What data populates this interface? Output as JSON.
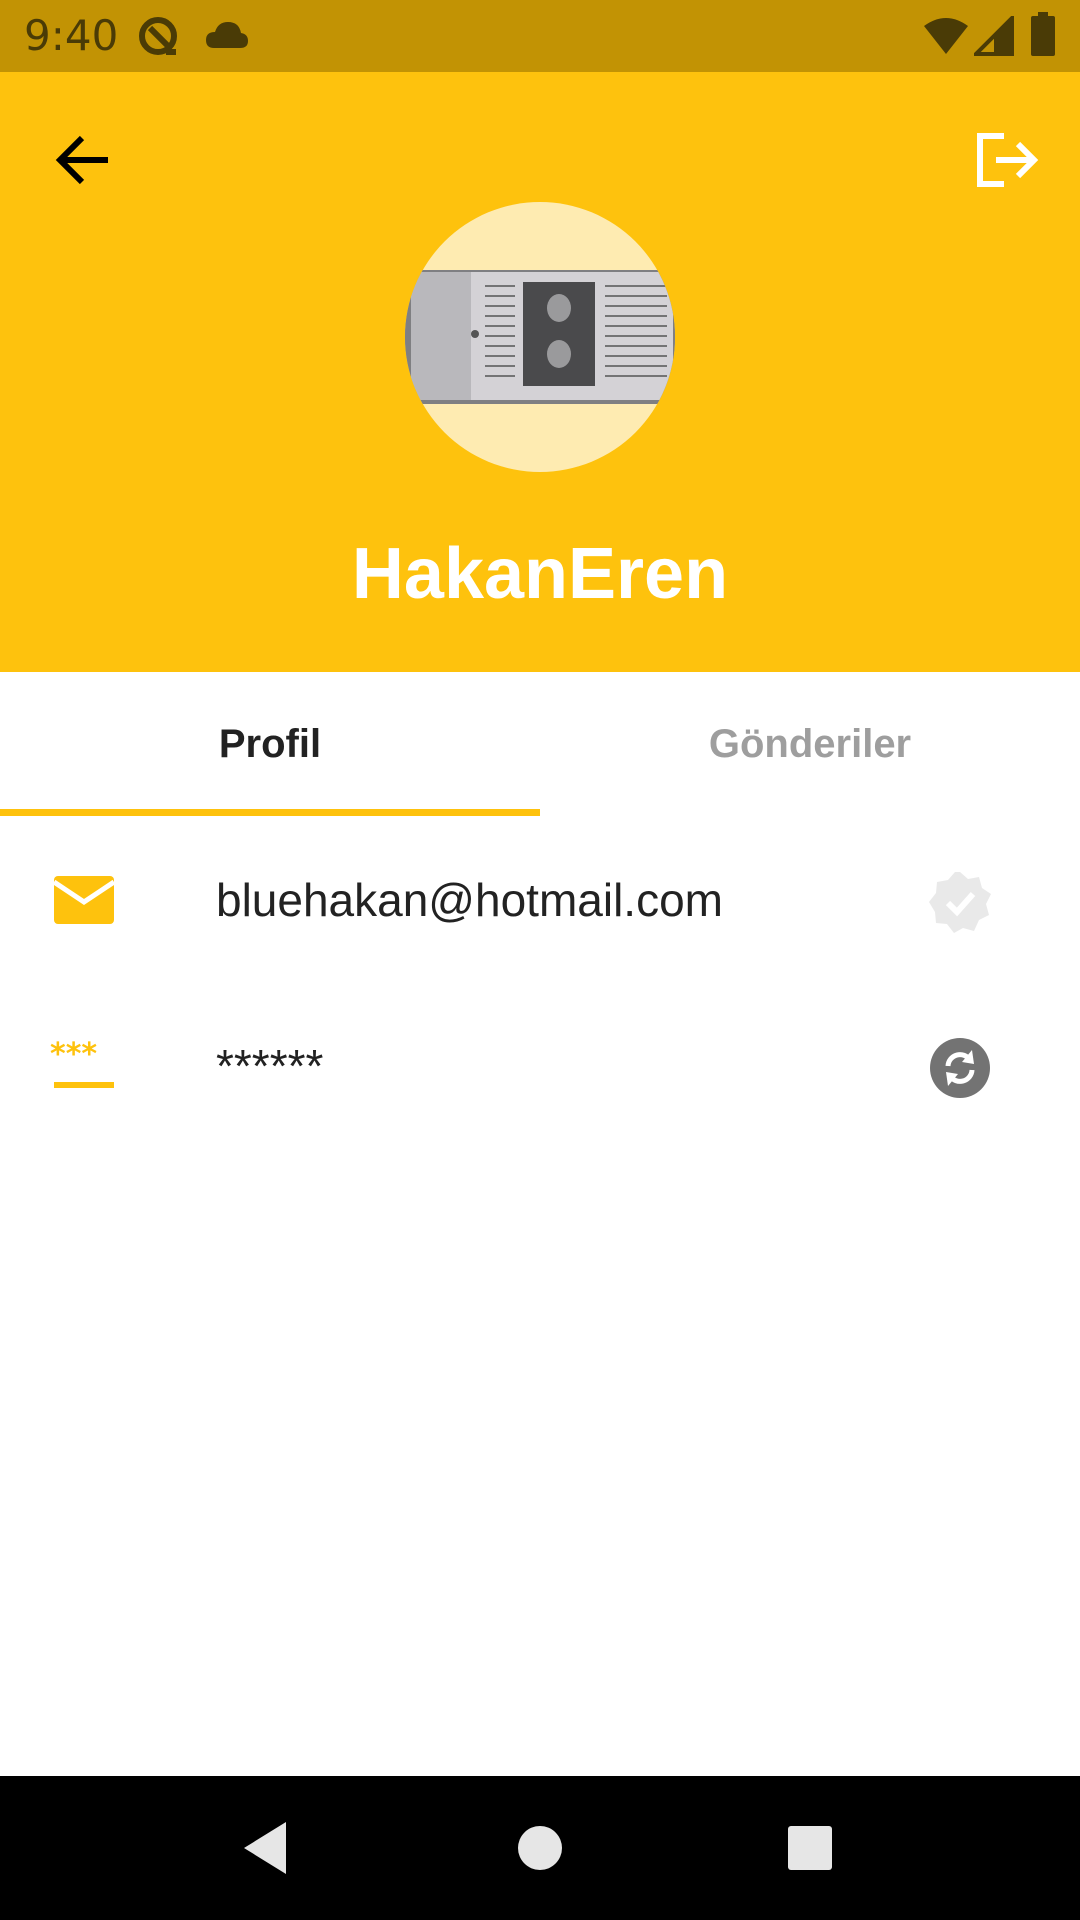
{
  "status_bar": {
    "time": "9:40",
    "left_icons": [
      "data-saver-icon",
      "cloud-icon"
    ],
    "right_icons": [
      "wifi-icon",
      "cell-signal-icon",
      "battery-icon"
    ]
  },
  "header": {
    "user_name": "HakanEren",
    "back_icon": "arrow-back-icon",
    "logout_icon": "logout-icon",
    "background_color": "#fec20d"
  },
  "tabs": [
    {
      "label": "Profil",
      "active": true
    },
    {
      "label": "Gönderiler",
      "active": false
    }
  ],
  "profile": {
    "email": "bluehakan@hotmail.com",
    "email_icon": "mail-icon",
    "email_status_icon": "verified-badge-icon",
    "password": "******",
    "password_icon": "password-icon",
    "password_action_icon": "sync-icon"
  },
  "nav_bar": {
    "buttons": [
      "back-triangle-icon",
      "home-circle-icon",
      "recents-square-icon"
    ]
  },
  "colors": {
    "accent": "#fec20d",
    "status_bar": "#c29304",
    "avatar_bg": "#feebb1",
    "text_dark": "#222222",
    "text_muted": "#9e9e9e"
  }
}
